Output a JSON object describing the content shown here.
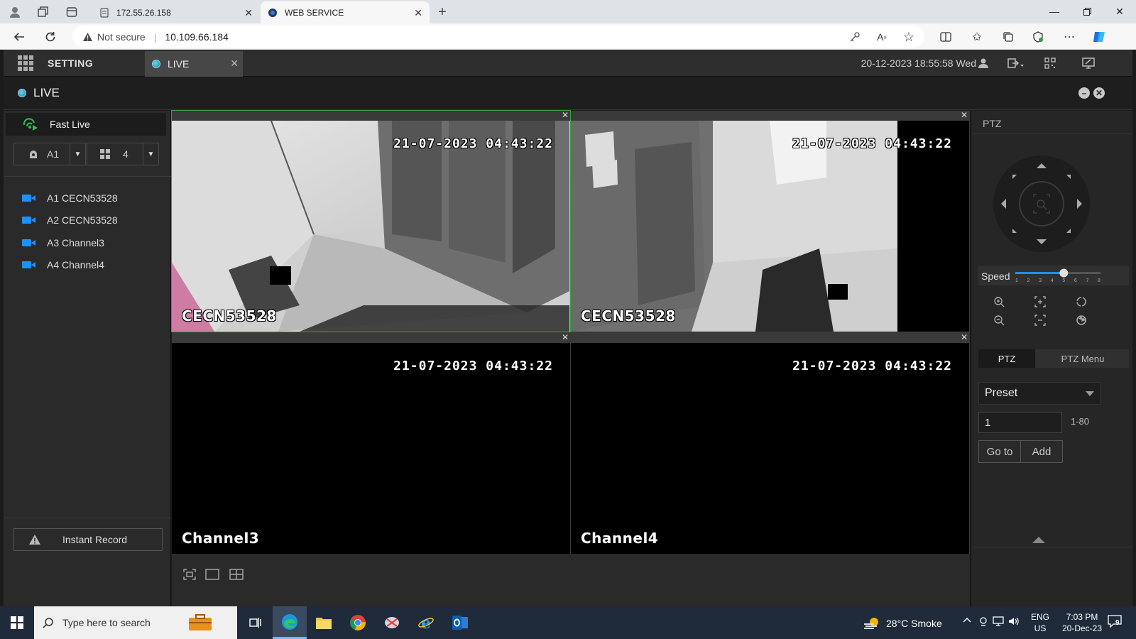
{
  "browser": {
    "tabs": [
      {
        "title": "172.55.26.158",
        "active": false
      },
      {
        "title": "WEB SERVICE",
        "active": true
      }
    ],
    "address": {
      "security": "Not secure",
      "url": "10.109.66.184"
    }
  },
  "app": {
    "setting_label": "SETTING",
    "live_tab_label": "LIVE",
    "datetime": "20-12-2023 18:55:58 Wed",
    "live_title": "LIVE"
  },
  "left_panel": {
    "fast_live": "Fast Live",
    "channel_select": "A1",
    "layout_select": "4",
    "channels": [
      {
        "label": "A1 CECN53528"
      },
      {
        "label": "A2 CECN53528"
      },
      {
        "label": "A3 Channel3"
      },
      {
        "label": "A4 Channel4"
      }
    ],
    "instant_record": "Instant Record"
  },
  "videos": [
    {
      "timestamp": "21-07-2023 04:43:22",
      "name": "CECN53528",
      "selected": true
    },
    {
      "timestamp": "21-07-2023 04:43:22",
      "name": "CECN53528",
      "selected": false
    },
    {
      "timestamp": "21-07-2023 04:43:22",
      "name": "Channel3",
      "selected": false
    },
    {
      "timestamp": "21-07-2023 04:43:22",
      "name": "Channel4",
      "selected": false
    }
  ],
  "ptz": {
    "title": "PTZ",
    "speed_label": "Speed",
    "speed_ticks": [
      "1",
      "2",
      "3",
      "4",
      "5",
      "6",
      "7",
      "8"
    ],
    "speed_value": 5,
    "tab_ptz": "PTZ",
    "tab_menu": "PTZ Menu",
    "preset_select": "Preset",
    "preset_number": "1",
    "preset_range": "1-80",
    "goto_label": "Go to",
    "add_label": "Add"
  },
  "taskbar": {
    "search_placeholder": "Type here to search",
    "weather": "28°C  Smoke",
    "lang_line1": "ENG",
    "lang_line2": "US",
    "time": "7:03 PM",
    "date": "20-Dec-23",
    "notification_count": "9"
  },
  "colors": {
    "accent_green": "#3aa043",
    "camera_icon_blue": "#1e90ff"
  }
}
